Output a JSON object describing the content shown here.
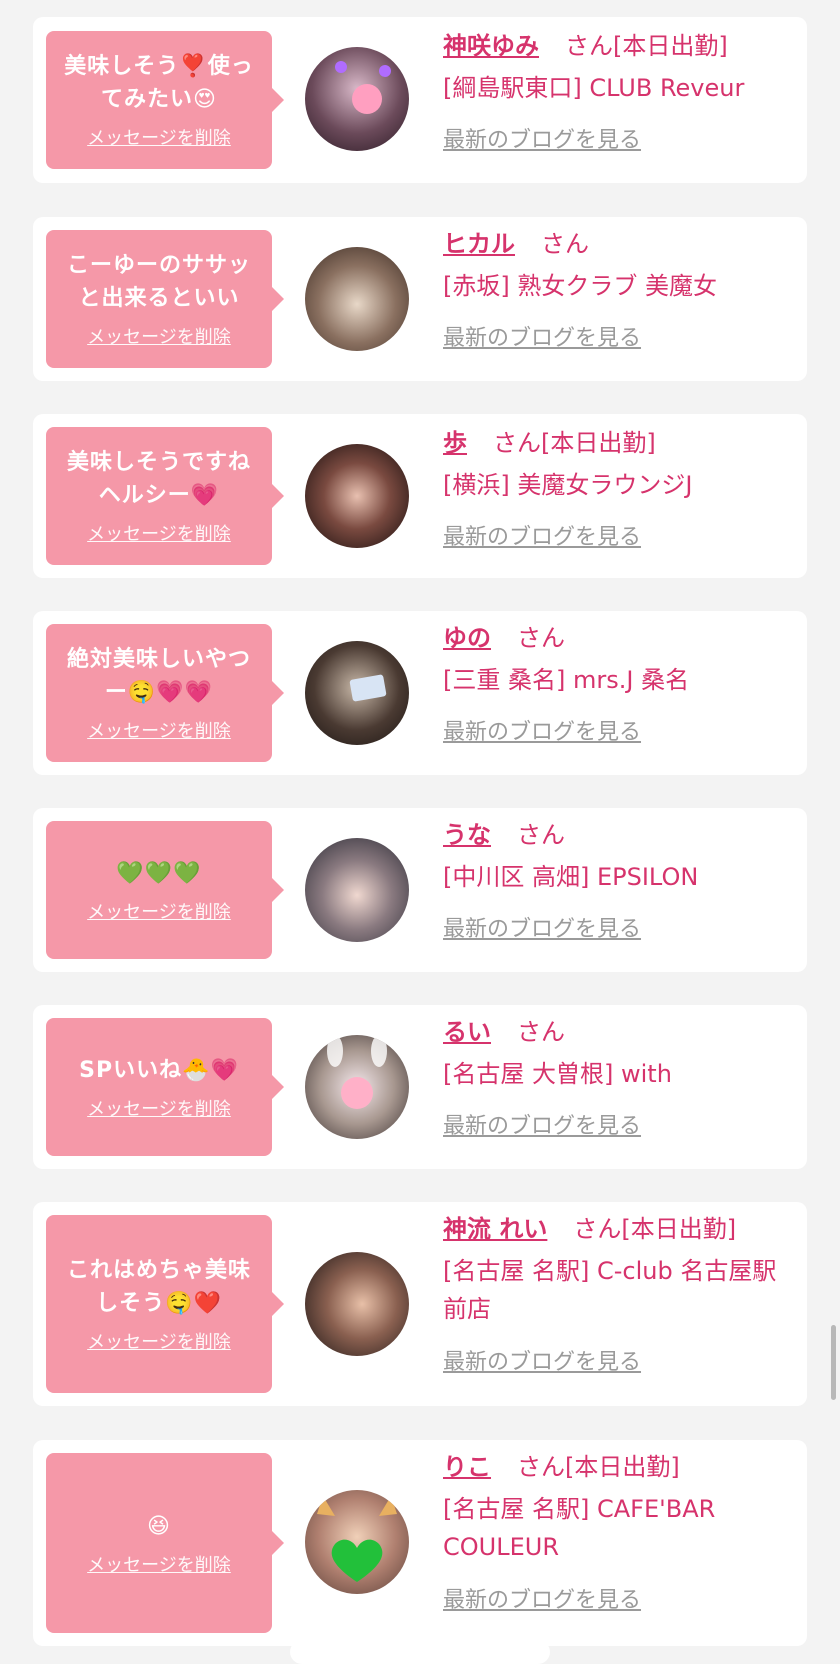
{
  "common": {
    "delete_label": "メッセージを削除",
    "blog_label": "最新のブログを見る",
    "san": "さん"
  },
  "colors": {
    "page_bg": "#f3f3f3",
    "bubble": "#f598a8",
    "accent": "#d6336c",
    "link_gray": "#9a9a9a"
  },
  "messages": [
    {
      "message": "美味しそう❣️使ってみたい😍",
      "name": "神咲ゆみ",
      "status": "[本日出勤]",
      "shop": "[綱島駅東口] CLUB Reveur"
    },
    {
      "message": "こーゆーのササッと出来るといい",
      "name": "ヒカル",
      "status": "",
      "shop": "[赤坂] 熟女クラブ 美魔女"
    },
    {
      "message": "美味しそうですねヘルシー💗",
      "name": "歩",
      "status": "[本日出勤]",
      "shop": "[横浜] 美魔女ラウンジJ"
    },
    {
      "message": "絶対美味しいやつー🤤💗💗",
      "name": "ゆの",
      "status": "",
      "shop": "[三重 桑名] mrs.J 桑名"
    },
    {
      "message": "💚💚💚",
      "name": "うな",
      "status": "",
      "shop": "[中川区 高畑] EPSILON"
    },
    {
      "message": "SPいいね🐣💗",
      "name": "るい",
      "status": "",
      "shop": "[名古屋 大曽根] with"
    },
    {
      "message": "これはめちゃ美味しそう🤤❤️",
      "name": "神流 れい",
      "status": "[本日出勤]",
      "shop": "[名古屋 名駅] C-club 名古屋駅前店"
    },
    {
      "message": "😆",
      "name": "りこ",
      "status": "[本日出勤]",
      "shop": "[名古屋 名駅] CAFE'BAR COULEUR"
    }
  ]
}
